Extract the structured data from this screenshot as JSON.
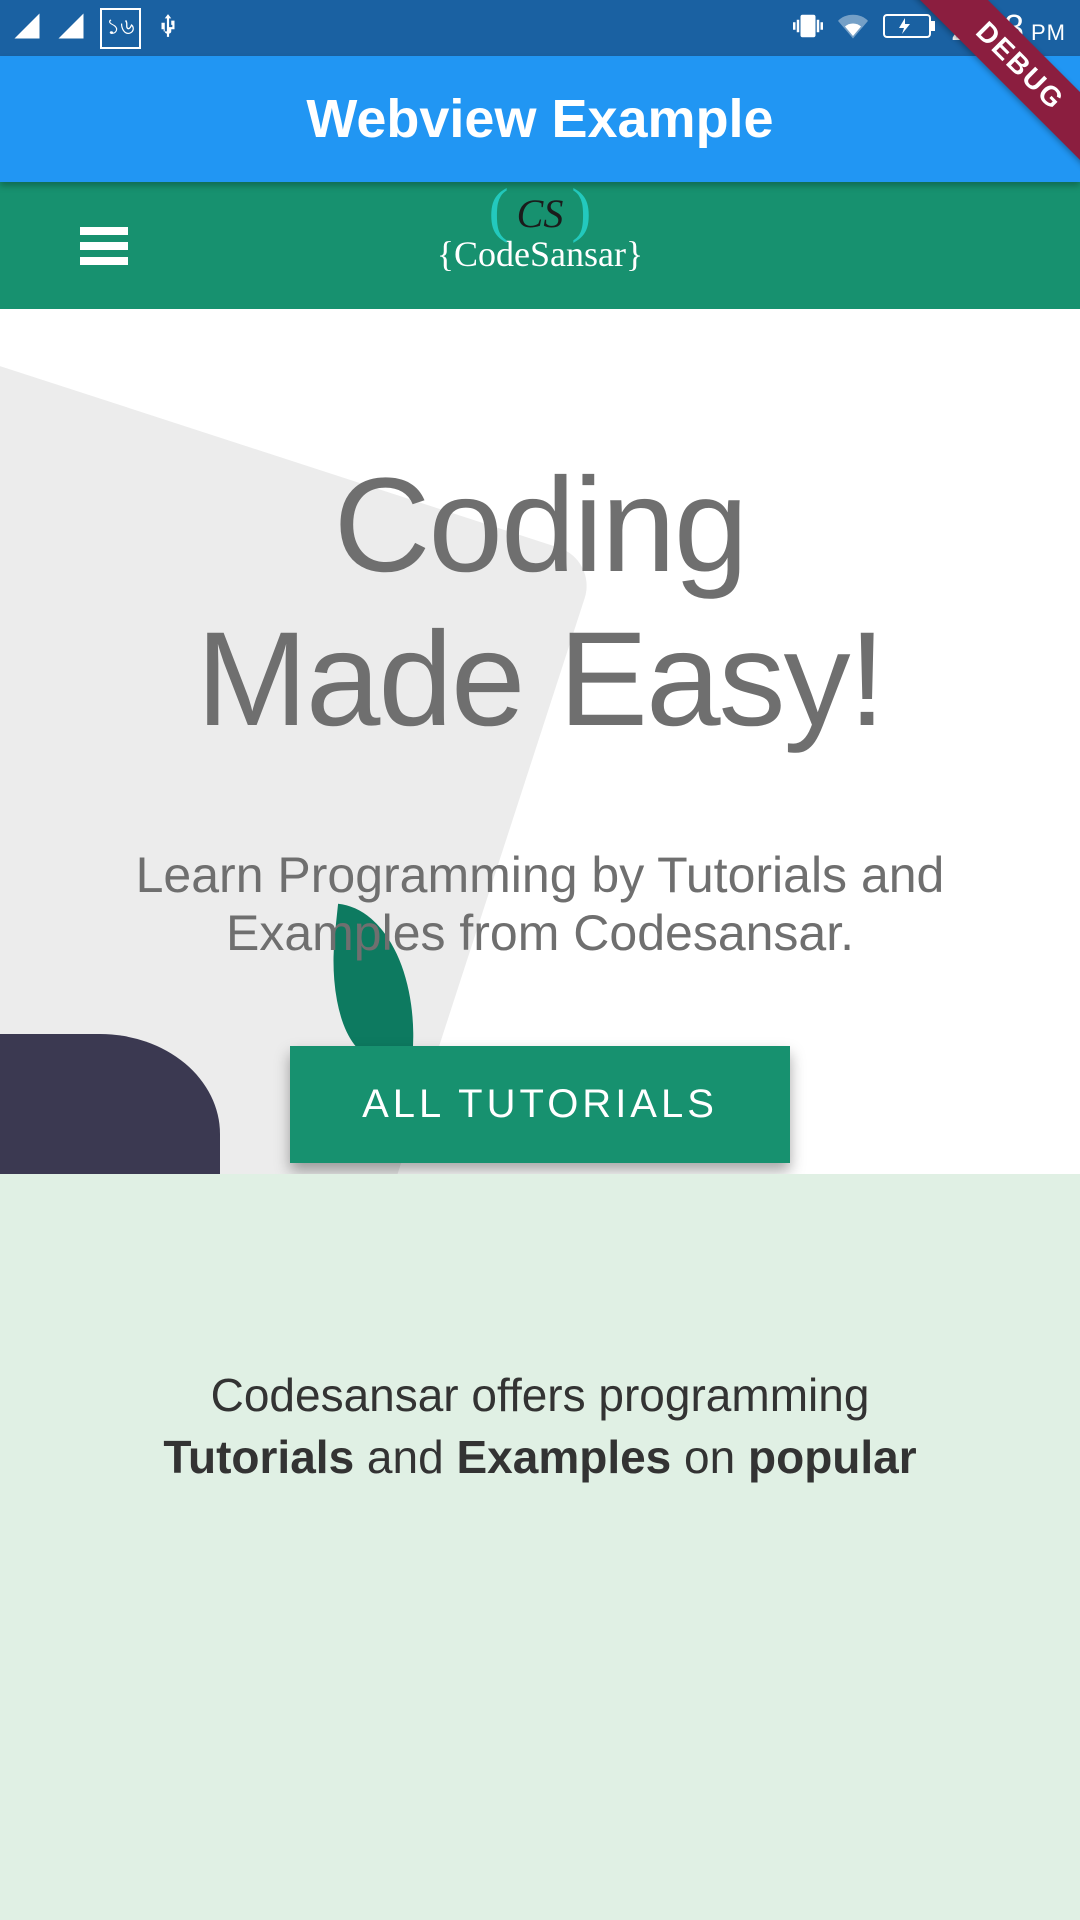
{
  "status": {
    "time": "2:18",
    "ampm": "PM"
  },
  "debug_ribbon": "DEBUG",
  "appbar": {
    "title": "Webview Example"
  },
  "site": {
    "logo_top": "CS",
    "logo_bottom": "{CodeSansar}"
  },
  "hero": {
    "heading_line1": "Coding",
    "heading_line2": "Made Easy!",
    "subheading": "Learn Programming by Tutorials and Examples from Codesansar.",
    "cta_label": "ALL TUTORIALS"
  },
  "body": {
    "line1": "Codesansar offers programming",
    "line2_bold1": "Tutorials",
    "line2_plain1": " and ",
    "line2_bold2": "Examples",
    "line2_plain2": " on ",
    "line2_bold3": "popular"
  }
}
